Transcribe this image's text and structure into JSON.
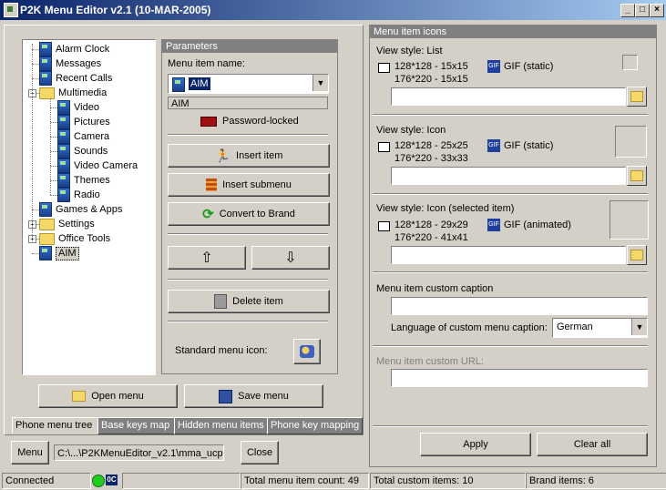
{
  "window": {
    "title": "P2K Menu Editor v2.1  (10-MAR-2005)",
    "minimize": "_",
    "maximize": "□",
    "close": "×"
  },
  "tree": {
    "items": [
      {
        "label": "Alarm Clock",
        "type": "item"
      },
      {
        "label": "Messages",
        "type": "item"
      },
      {
        "label": "Recent Calls",
        "type": "item"
      },
      {
        "label": "Multimedia",
        "type": "folder-open"
      },
      {
        "label": "Video",
        "type": "item"
      },
      {
        "label": "Pictures",
        "type": "item"
      },
      {
        "label": "Camera",
        "type": "item"
      },
      {
        "label": "Sounds",
        "type": "item"
      },
      {
        "label": "Video Camera",
        "type": "item"
      },
      {
        "label": "Themes",
        "type": "item"
      },
      {
        "label": "Radio",
        "type": "item"
      },
      {
        "label": "Games & Apps",
        "type": "item"
      },
      {
        "label": "Settings",
        "type": "folder"
      },
      {
        "label": "Office Tools",
        "type": "folder"
      },
      {
        "label": "AIM",
        "type": "item",
        "selected": true
      }
    ],
    "expand_minus": "−",
    "expand_plus": "+"
  },
  "parameters": {
    "title": "Parameters",
    "menu_item_name_label": "Menu item name:",
    "menu_item_name_value": "AIM",
    "menu_item_name_sub": "AIM",
    "password_locked": "Password-locked",
    "insert_item": "Insert item",
    "insert_submenu": "Insert submenu",
    "convert_to_brand": "Convert to Brand",
    "move_up": "⇧",
    "move_down": "⇩",
    "delete_item": "Delete item",
    "standard_menu_icon": "Standard menu icon:"
  },
  "left_buttons": {
    "open_menu": "Open menu",
    "save_menu": "Save menu"
  },
  "tabs": [
    "Phone menu tree",
    "Base keys map",
    "Hidden menu items",
    "Phone key mapping"
  ],
  "bottom": {
    "menu_button": "Menu",
    "path": "C:\\...\\P2KMenuEditor_v2.1\\mma_ucp",
    "close_button": "Close"
  },
  "icons_panel": {
    "title": "Menu item icons",
    "list": {
      "label": "View style: List",
      "size1": "128*128 - 15x15",
      "size2": "176*220 - 15x15",
      "format": "GIF (static)"
    },
    "icon": {
      "label": "View style: Icon",
      "size1": "128*128 - 25x25",
      "size2": "176*220 - 33x33",
      "format": "GIF (static)"
    },
    "icon_selected": {
      "label": "View style: Icon (selected item)",
      "size1": "128*128 - 29x29",
      "size2": "176*220 - 41x41",
      "format": "GIF (animated)"
    },
    "custom_caption_label": "Menu item custom caption",
    "language_label": "Language of custom menu caption:",
    "language_value": "German",
    "custom_url_label": "Menu item custom URL:",
    "apply": "Apply",
    "clear_all": "Clear all"
  },
  "status": {
    "connection": "Connected",
    "badge": "0C",
    "total_count": "Total menu item count: 49",
    "total_custom": "Total custom items: 10",
    "brand_items": "Brand items: 6"
  },
  "colors": {
    "title_start": "#0a246a",
    "title_end": "#a6caf0",
    "face": "#d4d0c8",
    "selection": "#0a246a",
    "led_green": "#22cc22"
  }
}
